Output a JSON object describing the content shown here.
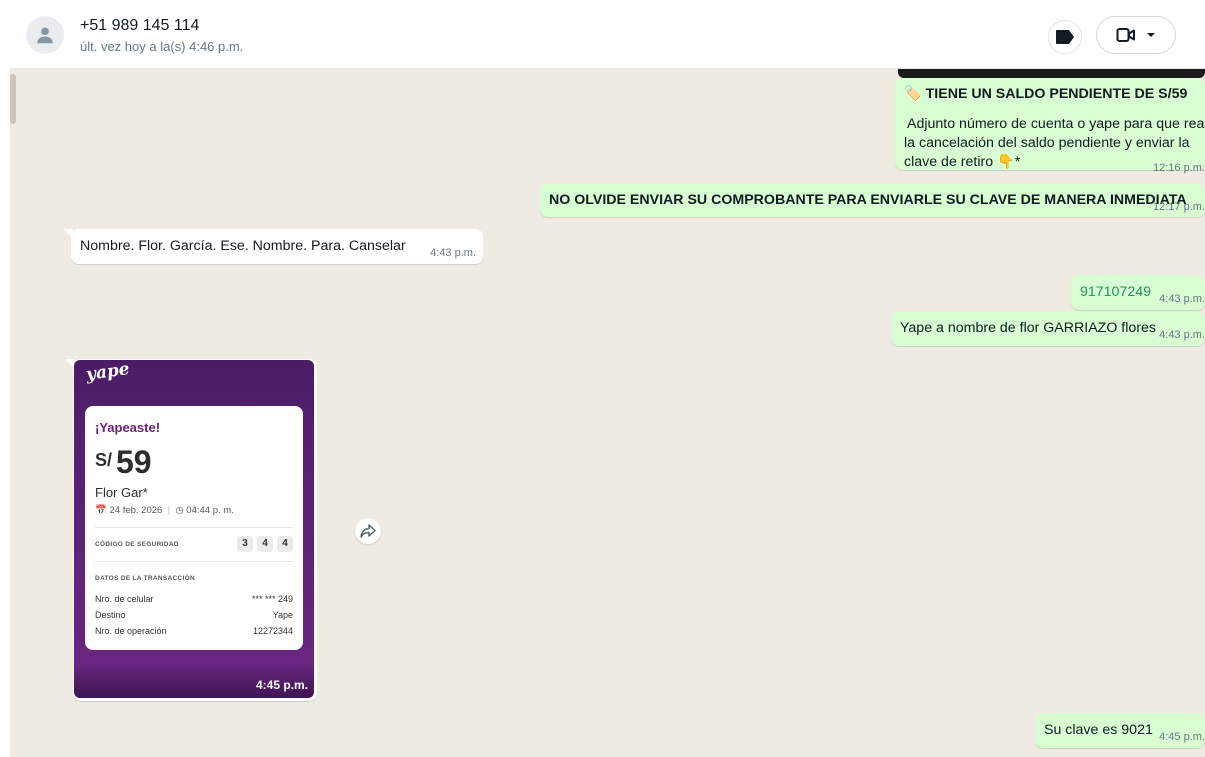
{
  "header": {
    "contact_name": "+51 989 145 114",
    "contact_status": "últ. vez hoy a la(s) 4:46 p.m.",
    "icons": [
      "person-icon",
      "label-icon",
      "video-camera-icon",
      "chevron-down-icon"
    ]
  },
  "colors": {
    "chat_background": "#efeae2",
    "outgoing_bubble": "#d9fdd3",
    "incoming_bubble": "#ffffff",
    "yape_purple": "#5b2176"
  },
  "messages": [
    {
      "direction": "out",
      "bold_line": "TIENE UN SALDO PENDIENTE DE S/59",
      "lines": [
        "Adjunto número de cuenta o yape para que real",
        "la cancelación del saldo pendiente y enviar la",
        "clave de retiro 👇*"
      ],
      "time": "12:16 p.m."
    },
    {
      "direction": "out",
      "text": "NO OLVIDE ENVIAR SU COMPROBANTE PARA ENVIARLE SU CLAVE DE MANERA INMEDIATA",
      "time": "12:17 p.m."
    },
    {
      "direction": "in",
      "text": "Nombre.  Flor.  García.  Ese.  Nombre.  Para.  Canselar",
      "time": "4:43 p.m."
    },
    {
      "direction": "out",
      "text": "917107249",
      "time": "4:43 p.m."
    },
    {
      "direction": "out",
      "text": "Yape a nombre de flor GARRIAZO flores",
      "time": "4:43 p.m."
    },
    {
      "direction": "out",
      "text": "Su clave es 9021",
      "time": "4:45 p.m."
    }
  ],
  "yape_receipt": {
    "logo": "yape",
    "title": "¡Yapeaste!",
    "currency": "S/",
    "amount": "59",
    "recipient": "Flor Gar*",
    "date": "24 feb. 2026",
    "time": "04:44 p. m.",
    "security_label": "CÓDIGO DE SEGURIDAD",
    "security_code": [
      "3",
      "4",
      "4"
    ],
    "details_label": "DATOS DE LA TRANSACCIÓN",
    "rows": [
      {
        "label": "Nro. de celular",
        "value": "*** *** 249"
      },
      {
        "label": "Destino",
        "value": "Yape"
      },
      {
        "label": "Nro. de operación",
        "value": "12272344"
      }
    ],
    "message_time": "4:45 p.m."
  }
}
